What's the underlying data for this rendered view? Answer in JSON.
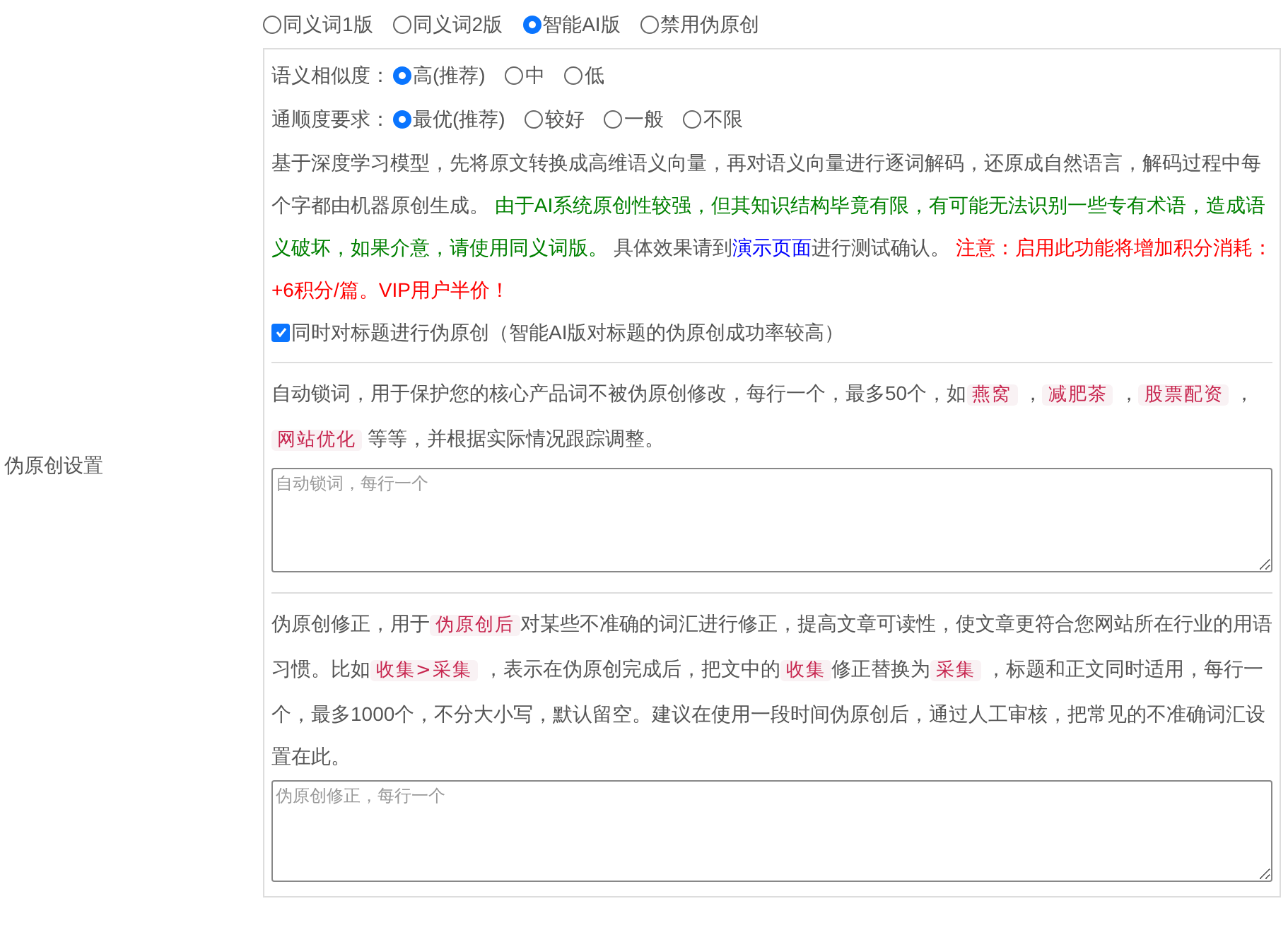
{
  "section_label": "伪原创设置",
  "modes": [
    {
      "label": "同义词1版",
      "selected": false
    },
    {
      "label": "同义词2版",
      "selected": false
    },
    {
      "label": "智能AI版",
      "selected": true
    },
    {
      "label": "禁用伪原创",
      "selected": false
    }
  ],
  "option_groups": [
    {
      "label": "语义相似度：",
      "options": [
        {
          "label": "高(推荐)",
          "selected": true
        },
        {
          "label": "中",
          "selected": false
        },
        {
          "label": "低",
          "selected": false
        }
      ]
    },
    {
      "label": "通顺度要求：",
      "options": [
        {
          "label": "最优(推荐)",
          "selected": true
        },
        {
          "label": "较好",
          "selected": false
        },
        {
          "label": "一般",
          "selected": false
        },
        {
          "label": "不限",
          "selected": false
        }
      ]
    }
  ],
  "description": [
    {
      "kind": "text",
      "text": "基于深度学习模型，先将原文转换成高维语义向量，再对语义向量进行逐词解码，还原成自然语言，解码过程中每个字都由机器原创生成。 "
    },
    {
      "kind": "note",
      "text": "由于AI系统原创性较强，但其知识结构毕竟有限，有可能无法识别一些专有术语，造成语义破坏，如果介意，请使用同义词版。"
    },
    {
      "kind": "text",
      "text": " 具体效果请到"
    },
    {
      "kind": "link",
      "text": "演示页面"
    },
    {
      "kind": "text",
      "text": "进行测试确认。 "
    },
    {
      "kind": "warning",
      "text": "注意：启用此功能将增加积分消耗：+6积分/篇。VIP用户半价！"
    }
  ],
  "title_option": {
    "label": "同时对标题进行伪原创（智能AI版对标题的伪原创成功率较高）",
    "checked": true
  },
  "lock_words": {
    "description": [
      {
        "kind": "text",
        "text": "自动锁词，用于保护您的核心产品词不被伪原创修改，每行一个，最多50个，如"
      },
      {
        "kind": "code",
        "text": "燕窝"
      },
      {
        "kind": "text",
        "text": " ，"
      },
      {
        "kind": "code",
        "text": "减肥茶"
      },
      {
        "kind": "text",
        "text": " ，"
      },
      {
        "kind": "code",
        "text": "股票配资"
      },
      {
        "kind": "text",
        "text": " ，"
      },
      {
        "kind": "code",
        "text": "网站优化"
      },
      {
        "kind": "text",
        "text": " 等等，并根据实际情况跟踪调整。"
      }
    ],
    "placeholder": "自动锁词，每行一个"
  },
  "corrections": {
    "description": [
      {
        "kind": "text",
        "text": "伪原创修正，用于"
      },
      {
        "kind": "code",
        "text": "伪原创后"
      },
      {
        "kind": "text",
        "text": "对某些不准确的词汇进行修正，提高文章可读性，使文章更符合您网站所在行业的用语习惯。比如"
      },
      {
        "kind": "code",
        "text": "收集>采集"
      },
      {
        "kind": "text",
        "text": " ，表示在伪原创完成后，把文中的"
      },
      {
        "kind": "code",
        "text": "收集"
      },
      {
        "kind": "text",
        "text": "修正替换为"
      },
      {
        "kind": "code",
        "text": "采集"
      },
      {
        "kind": "text",
        "text": " ，标题和正文同时适用，每行一个，最多1000个，不分大小写，默认留空。建议在使用一段时间伪原创后，通过人工审核，把常见的不准确词汇设置在此。"
      }
    ],
    "placeholder": "伪原创修正，每行一个"
  }
}
